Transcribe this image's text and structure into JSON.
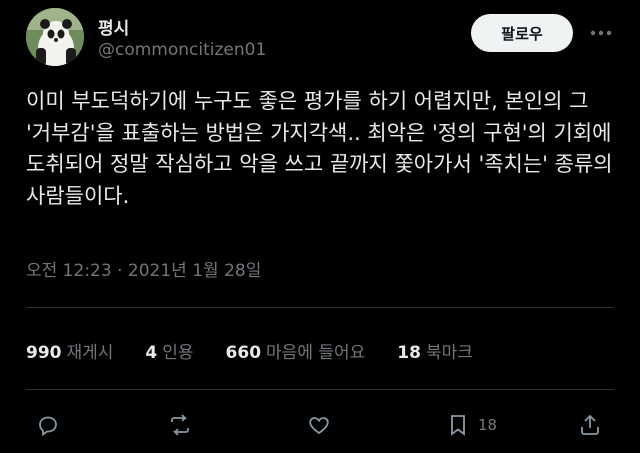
{
  "author": {
    "name": "평시",
    "handle": "@commoncitizen01",
    "avatar_icon": "panda-avatar"
  },
  "follow_label": "팔로우",
  "more_icon": "more-options-icon",
  "tweet": {
    "text": "이미 부도덕하기에 누구도 좋은 평가를 하기 어렵지만, 본인의 그 '거부감'을 표출하는 방법은 가지각색.. 최악은 '정의 구현'의 기회에 도취되어 정말 작심하고 악을 쓰고 끝까지 쫓아가서 '족치는' 종류의 사람들이다.",
    "time": "오전 12:23",
    "separator": "·",
    "date": "2021년 1월 28일"
  },
  "stats": [
    {
      "num": "990",
      "label": "재게시"
    },
    {
      "num": "4",
      "label": "인용"
    },
    {
      "num": "660",
      "label": "마음에 들어요"
    },
    {
      "num": "18",
      "label": "북마크"
    }
  ],
  "actions": {
    "bookmark_count": "18"
  },
  "colors": {
    "background": "#000000",
    "text": "#e7e9ea",
    "secondary": "#71767b",
    "follow_button": "#eff3f4"
  }
}
